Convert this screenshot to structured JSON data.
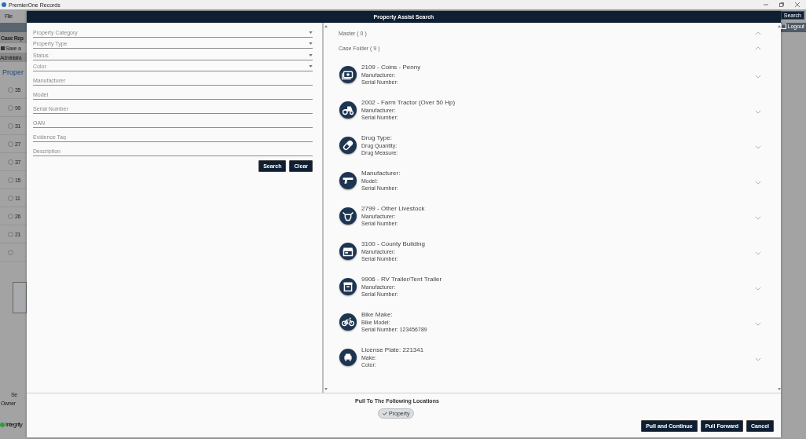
{
  "app_window": {
    "title": "PremierOne Records",
    "menu": [
      "File"
    ],
    "background": {
      "tab": "Case Rep",
      "toolbar": "Save a",
      "subtab": "Administra",
      "heading": "Proper",
      "rows": [
        "35",
        "99",
        "31",
        "27",
        "37",
        "15",
        "11",
        "26",
        "21"
      ],
      "footer_labels": [
        "Se",
        "Owner"
      ],
      "status": "Integrity",
      "search_button": "Search",
      "logout": "Logout"
    }
  },
  "dialog": {
    "title": "Property Assist Search",
    "fields": [
      {
        "kind": "select",
        "placeholder": "Property Category"
      },
      {
        "kind": "select",
        "placeholder": "Property Type"
      },
      {
        "kind": "select",
        "placeholder": "Status"
      },
      {
        "kind": "select",
        "placeholder": "Color"
      },
      {
        "kind": "text",
        "placeholder": "Manufacturer"
      },
      {
        "kind": "text",
        "placeholder": "Model"
      },
      {
        "kind": "text",
        "placeholder": "Serial Number"
      },
      {
        "kind": "text",
        "placeholder": "OAN"
      },
      {
        "kind": "text",
        "placeholder": "Evidence Tag"
      },
      {
        "kind": "text",
        "placeholder": "Description"
      }
    ],
    "form_buttons": [
      "Search",
      "Clear"
    ],
    "sections": [
      {
        "label": "Master ( 0 )",
        "expanded": true
      },
      {
        "label": "Case Folder ( 9 )",
        "expanded": true,
        "items": [
          {
            "kind": "money",
            "title": "2109 - Coins - Penny",
            "lines": [
              "Manufacturer:",
              "Serial Number:"
            ],
            "expanded": false
          },
          {
            "kind": "tractor",
            "title": "2002 - Farm Tractor (Over 50 Hp)",
            "lines": [
              "Manufacturer:",
              "Serial Number:"
            ],
            "expanded": false
          },
          {
            "kind": "pill",
            "title": "Drug Type:",
            "lines": [
              "Drug Quantity:",
              "Drug Measure:"
            ],
            "expanded": false
          },
          {
            "kind": "gun",
            "title": "Manufacturer:",
            "lines": [
              "Model:",
              "Serial Number:"
            ],
            "expanded": false
          },
          {
            "kind": "cow",
            "title": "2799 - Other Livestock",
            "lines": [
              "Manufacturer:",
              "Serial Number:"
            ],
            "expanded": false
          },
          {
            "kind": "building",
            "title": "3100 - County Building",
            "lines": [
              "Manufacturer:",
              "Serial Number:"
            ],
            "expanded": false
          },
          {
            "kind": "box",
            "title": "9906 - RV Trailer/Tent Trailer",
            "lines": [
              "Manufacturer:",
              "Serial Number:"
            ],
            "expanded": false
          },
          {
            "kind": "bike",
            "title": "Bike Make:",
            "lines": [
              "Bike Model:",
              "Serial Number: 123456789"
            ],
            "expanded": false
          },
          {
            "kind": "car",
            "title": "License Plate: 221341",
            "lines": [
              "Make:",
              "Color:"
            ],
            "expanded": false
          }
        ]
      }
    ],
    "pull": {
      "heading": "Pull To The Following Locations",
      "locations": [
        {
          "label": "Property",
          "checked": true
        }
      ]
    },
    "buttons": [
      "Pull and Continue",
      "Pull Forward",
      "Cancel"
    ]
  }
}
